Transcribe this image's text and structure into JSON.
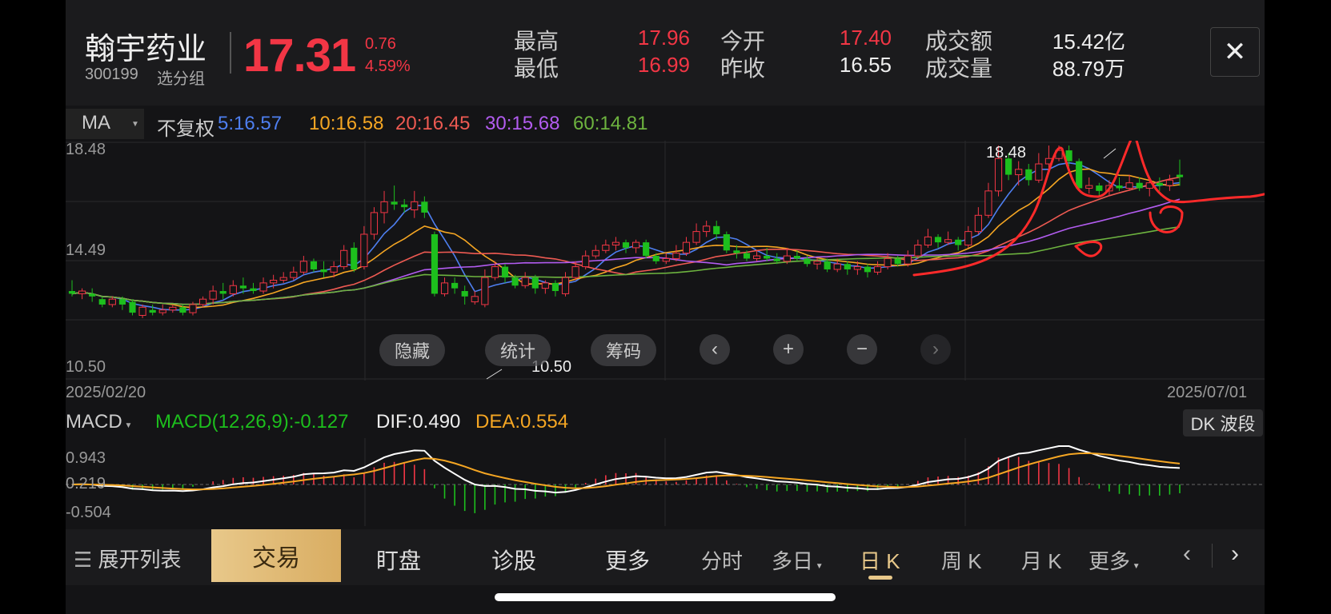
{
  "header": {
    "name": "翰宇药业",
    "code": "300199",
    "group": "选分组",
    "price": "17.31",
    "change": "0.76",
    "change_pct": "4.59%",
    "high_label": "最高",
    "high": "17.96",
    "low_label": "最低",
    "low": "16.99",
    "open_label": "今开",
    "open": "17.40",
    "prev_label": "昨收",
    "prev": "16.55",
    "amount_label": "成交额",
    "amount": "15.42亿",
    "volume_label": "成交量",
    "volume": "88.79万",
    "close_icon": "close-icon"
  },
  "ma": {
    "select": "MA",
    "fq": "不复权",
    "ma5": "5:16.57",
    "ma10": "10:16.58",
    "ma20": "20:16.45",
    "ma30": "30:15.68",
    "ma60": "60:14.81"
  },
  "kline": {
    "y_top": "18.48",
    "y_mid": "14.49",
    "y_bot": "10.50",
    "date_start": "2025/02/20",
    "date_end": "2025/07/01",
    "hi_mark": "18.48",
    "lo_mark": "10.50"
  },
  "overlay": {
    "hide": "隐藏",
    "stats": "统计",
    "chips": "筹码"
  },
  "macd": {
    "select": "MACD",
    "macd": "MACD(12,26,9):-0.127",
    "dif_label": "DIF:",
    "dif": "0.490",
    "dea": "DEA:0.554",
    "y_top": "0.943",
    "y_mid": "0.219",
    "y_bot": "-0.504",
    "dk": "DK 波段"
  },
  "bottom": {
    "expand": "展开列表",
    "trade": "交易",
    "watch": "盯盘",
    "diagnose": "诊股",
    "more1": "更多",
    "fenshi": "分时",
    "duori": "多日",
    "dayk": "日 K",
    "weekk": "周 K",
    "monthk": "月 K",
    "more2": "更多"
  },
  "colors": {
    "up": "#f23645",
    "down": "#1dbf1d",
    "ma5": "#4e7ff0",
    "ma10": "#f5a623",
    "ma20": "#ee5a52",
    "ma30": "#b25cf0",
    "ma60": "#6db33f"
  },
  "chart_data": {
    "type": "candlestick",
    "ylim": [
      10.5,
      18.48
    ],
    "candles": [
      [
        13.1,
        13.0,
        13.5,
        12.9
      ],
      [
        13.0,
        13.1,
        13.2,
        12.8
      ],
      [
        13.0,
        12.9,
        13.2,
        12.7
      ],
      [
        12.8,
        12.6,
        12.9,
        12.5
      ],
      [
        12.6,
        12.8,
        12.9,
        12.5
      ],
      [
        12.8,
        12.6,
        12.9,
        12.4
      ],
      [
        12.7,
        12.3,
        12.8,
        12.2
      ],
      [
        12.2,
        12.5,
        12.6,
        12.1
      ],
      [
        12.4,
        12.3,
        12.6,
        12.2
      ],
      [
        12.3,
        12.4,
        12.6,
        12.2
      ],
      [
        12.4,
        12.5,
        12.6,
        12.3
      ],
      [
        12.5,
        12.3,
        12.6,
        12.2
      ],
      [
        12.3,
        12.6,
        12.7,
        12.2
      ],
      [
        12.6,
        12.8,
        12.9,
        12.5
      ],
      [
        12.8,
        13.1,
        13.3,
        12.6
      ],
      [
        13.1,
        13.0,
        13.4,
        12.8
      ],
      [
        13.0,
        13.3,
        13.5,
        12.9
      ],
      [
        13.3,
        13.2,
        13.6,
        13.0
      ],
      [
        13.2,
        13.1,
        13.4,
        13.0
      ],
      [
        13.1,
        13.4,
        13.6,
        13.0
      ],
      [
        13.4,
        13.5,
        13.7,
        13.2
      ],
      [
        13.5,
        13.6,
        13.8,
        13.4
      ],
      [
        13.6,
        13.8,
        14.0,
        13.5
      ],
      [
        13.8,
        14.2,
        14.4,
        13.7
      ],
      [
        14.2,
        13.9,
        14.3,
        13.8
      ],
      [
        13.9,
        13.8,
        14.2,
        13.6
      ],
      [
        13.8,
        14.0,
        14.2,
        13.6
      ],
      [
        14.0,
        14.6,
        14.8,
        13.9
      ],
      [
        14.7,
        13.9,
        14.9,
        13.8
      ],
      [
        14.0,
        15.2,
        15.5,
        13.9
      ],
      [
        15.2,
        16.0,
        16.2,
        15.0
      ],
      [
        16.0,
        16.4,
        16.8,
        15.6
      ],
      [
        16.4,
        16.3,
        17.0,
        16.1
      ],
      [
        16.3,
        16.2,
        16.5,
        16.0
      ],
      [
        16.1,
        16.4,
        16.8,
        15.8
      ],
      [
        16.4,
        16.0,
        16.6,
        15.8
      ],
      [
        15.2,
        13.0,
        15.3,
        12.9
      ],
      [
        13.0,
        13.4,
        13.6,
        12.9
      ],
      [
        13.4,
        13.2,
        13.6,
        13.0
      ],
      [
        13.1,
        12.9,
        13.3,
        12.6
      ],
      [
        12.7,
        12.9,
        13.1,
        12.6
      ],
      [
        12.6,
        13.6,
        13.9,
        12.5
      ],
      [
        13.6,
        14.0,
        14.2,
        13.5
      ],
      [
        14.0,
        13.6,
        14.1,
        13.4
      ],
      [
        13.6,
        13.3,
        13.7,
        13.2
      ],
      [
        13.3,
        13.6,
        13.8,
        13.2
      ],
      [
        13.6,
        13.2,
        13.7,
        13.0
      ],
      [
        13.2,
        13.4,
        13.5,
        13.0
      ],
      [
        13.4,
        13.1,
        13.5,
        12.9
      ],
      [
        13.0,
        13.6,
        13.8,
        12.9
      ],
      [
        13.6,
        14.0,
        14.2,
        13.5
      ],
      [
        14.0,
        14.4,
        14.6,
        13.9
      ],
      [
        14.4,
        14.6,
        14.8,
        14.3
      ],
      [
        14.6,
        14.8,
        15.0,
        14.5
      ],
      [
        14.8,
        14.9,
        15.1,
        14.6
      ],
      [
        14.9,
        14.7,
        15.0,
        14.5
      ],
      [
        14.7,
        14.9,
        15.0,
        14.5
      ],
      [
        14.9,
        14.4,
        15.0,
        14.3
      ],
      [
        14.4,
        14.2,
        14.5,
        14.1
      ],
      [
        14.2,
        14.3,
        14.5,
        14.1
      ],
      [
        14.3,
        14.5,
        14.8,
        14.2
      ],
      [
        14.5,
        14.9,
        15.1,
        14.4
      ],
      [
        14.9,
        15.3,
        15.6,
        14.8
      ],
      [
        15.3,
        15.5,
        15.7,
        15.1
      ],
      [
        15.5,
        15.2,
        15.7,
        15.0
      ],
      [
        15.2,
        14.6,
        15.3,
        14.5
      ],
      [
        14.6,
        14.5,
        14.8,
        14.3
      ],
      [
        14.5,
        14.3,
        14.6,
        14.2
      ],
      [
        14.3,
        14.4,
        14.6,
        14.2
      ],
      [
        14.4,
        14.3,
        14.7,
        14.2
      ],
      [
        14.3,
        14.2,
        14.5,
        14.1
      ],
      [
        14.2,
        14.4,
        14.7,
        14.1
      ],
      [
        14.4,
        14.3,
        14.6,
        14.2
      ],
      [
        14.3,
        14.1,
        14.4,
        14.0
      ],
      [
        14.1,
        14.2,
        14.3,
        13.9
      ],
      [
        14.2,
        13.9,
        14.3,
        13.8
      ],
      [
        13.9,
        14.1,
        14.3,
        13.8
      ],
      [
        14.1,
        13.9,
        14.2,
        13.7
      ],
      [
        13.9,
        14.0,
        14.2,
        13.7
      ],
      [
        14.0,
        13.8,
        14.1,
        13.6
      ],
      [
        13.8,
        14.0,
        14.2,
        13.7
      ],
      [
        14.0,
        14.3,
        14.5,
        13.9
      ],
      [
        14.3,
        14.1,
        14.4,
        14.0
      ],
      [
        14.1,
        14.4,
        14.6,
        14.0
      ],
      [
        14.4,
        14.8,
        15.0,
        14.3
      ],
      [
        14.8,
        15.1,
        15.4,
        14.7
      ],
      [
        15.1,
        14.9,
        15.2,
        14.7
      ],
      [
        14.9,
        15.0,
        15.3,
        14.8
      ],
      [
        15.0,
        14.8,
        15.1,
        14.6
      ],
      [
        14.8,
        15.3,
        15.5,
        14.7
      ],
      [
        15.3,
        15.9,
        16.2,
        15.2
      ],
      [
        15.9,
        16.8,
        17.1,
        15.8
      ],
      [
        16.8,
        18.0,
        18.48,
        16.6
      ],
      [
        18.0,
        17.4,
        18.2,
        17.2
      ],
      [
        17.4,
        17.6,
        17.9,
        17.0
      ],
      [
        17.6,
        17.2,
        17.8,
        17.0
      ],
      [
        17.2,
        17.8,
        18.2,
        17.1
      ],
      [
        17.8,
        18.0,
        18.48,
        17.6
      ],
      [
        18.0,
        18.3,
        18.48,
        17.9
      ],
      [
        18.3,
        17.9,
        18.48,
        17.7
      ],
      [
        17.9,
        16.9,
        18.0,
        16.8
      ],
      [
        16.9,
        17.0,
        17.3,
        16.7
      ],
      [
        17.0,
        16.8,
        17.1,
        16.6
      ],
      [
        16.8,
        17.0,
        17.2,
        16.6
      ],
      [
        17.0,
        16.9,
        17.3,
        16.8
      ],
      [
        16.9,
        17.1,
        17.4,
        16.8
      ],
      [
        17.1,
        16.9,
        17.3,
        16.8
      ],
      [
        16.9,
        17.1,
        17.2,
        16.6
      ],
      [
        17.1,
        17.0,
        17.3,
        16.8
      ],
      [
        17.0,
        17.2,
        17.4,
        16.8
      ],
      [
        17.4,
        17.31,
        17.96,
        16.99
      ]
    ]
  }
}
